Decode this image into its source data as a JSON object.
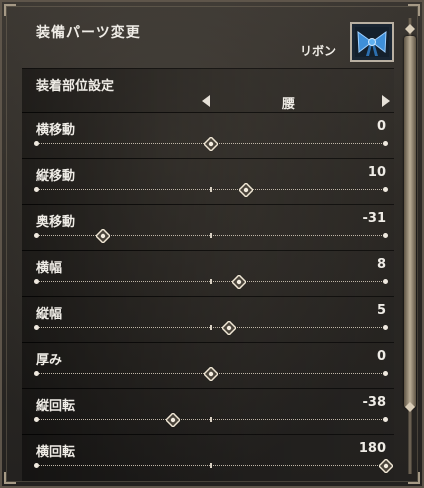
{
  "header": {
    "title": "装備パーツ変更",
    "item_name": "リボン",
    "item_icon": "ribbon-icon"
  },
  "placement": {
    "label": "装着部位設定",
    "value": "腰"
  },
  "sliders": [
    {
      "label": "横移動",
      "value": "0",
      "position": 0.5
    },
    {
      "label": "縦移動",
      "value": "10",
      "position": 0.6
    },
    {
      "label": "奥移動",
      "value": "-31",
      "position": 0.19
    },
    {
      "label": "横幅",
      "value": "8",
      "position": 0.58
    },
    {
      "label": "縦幅",
      "value": "5",
      "position": 0.55
    },
    {
      "label": "厚み",
      "value": "0",
      "position": 0.5
    },
    {
      "label": "縦回転",
      "value": "-38",
      "position": 0.39
    },
    {
      "label": "横回転",
      "value": "180",
      "position": 1.0
    }
  ],
  "colors": {
    "panel": "#2c2925",
    "text": "#efece6",
    "accent": "#b9b0a2",
    "ribbon": "#3e8fd8"
  }
}
